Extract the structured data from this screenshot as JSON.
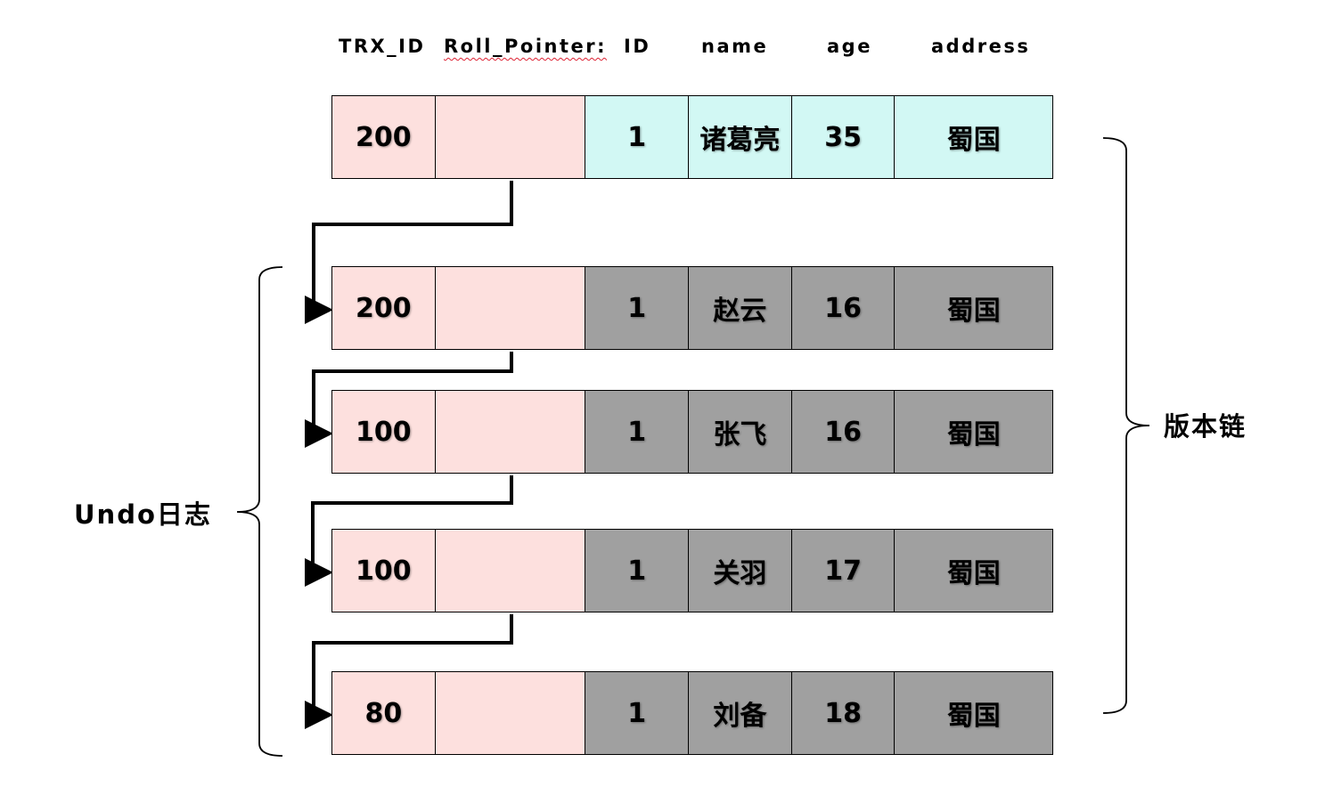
{
  "colors": {
    "trx_fill": "#fde0de",
    "current_data_fill": "#d2f8f4",
    "history_data_fill": "#a0a0a0",
    "line": "#000000"
  },
  "headers": [
    "TRX_ID",
    "Roll_Pointer:",
    "ID",
    "name",
    "age",
    "address"
  ],
  "rows": [
    {
      "trx_id": "200",
      "roll_pointer": "",
      "id": "1",
      "name": "诸葛亮",
      "age": "35",
      "address": "蜀国",
      "version": "current"
    },
    {
      "trx_id": "200",
      "roll_pointer": "",
      "id": "1",
      "name": "赵云",
      "age": "16",
      "address": "蜀国",
      "version": "undo"
    },
    {
      "trx_id": "100",
      "roll_pointer": "",
      "id": "1",
      "name": "张飞",
      "age": "16",
      "address": "蜀国",
      "version": "undo"
    },
    {
      "trx_id": "100",
      "roll_pointer": "",
      "id": "1",
      "name": "关羽",
      "age": "17",
      "address": "蜀国",
      "version": "undo"
    },
    {
      "trx_id": "80",
      "roll_pointer": "",
      "id": "1",
      "name": "刘备",
      "age": "18",
      "address": "蜀国",
      "version": "undo"
    }
  ],
  "labels": {
    "undo_log": "Undo日志",
    "version_chain": "版本链"
  }
}
